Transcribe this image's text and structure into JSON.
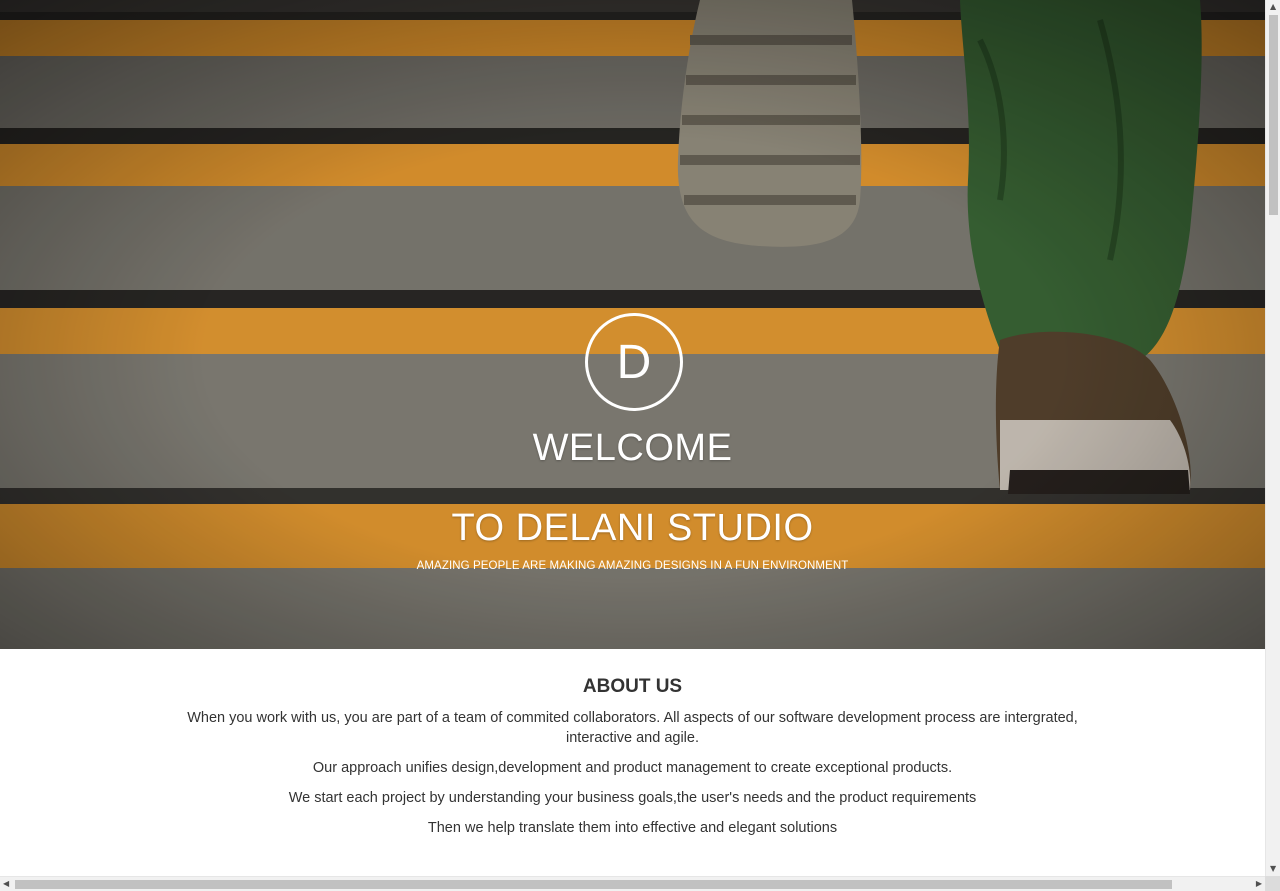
{
  "hero": {
    "logo_letter": "D",
    "title_line1": "WELCOME",
    "title_line2": "TO DELANI STUDIO",
    "tagline": "AMAZING PEOPLE ARE MAKING AMAZING DESIGNS IN A FUN ENVIRONMENT",
    "background_image": "stairs-with-orange-stripes-and-walking-feet"
  },
  "about": {
    "heading": "ABOUT US",
    "paragraphs": [
      "When you work with us, you are part of a team of commited collaborators. All aspects of our software development process are intergrated, interactive and agile.",
      "Our approach unifies design,development and product management to create exceptional products.",
      "We start each project by understanding your business goals,the user's needs and the product requirements",
      "Then we help translate them into effective and elegant solutions"
    ]
  },
  "scrollbars": {
    "up_arrow": "▲",
    "down_arrow": "▼",
    "left_arrow": "◀",
    "right_arrow": "▶"
  },
  "colors": {
    "stripe_orange": "#f0a030",
    "step_gray": "#6e6b63",
    "text_dark": "#333333"
  }
}
